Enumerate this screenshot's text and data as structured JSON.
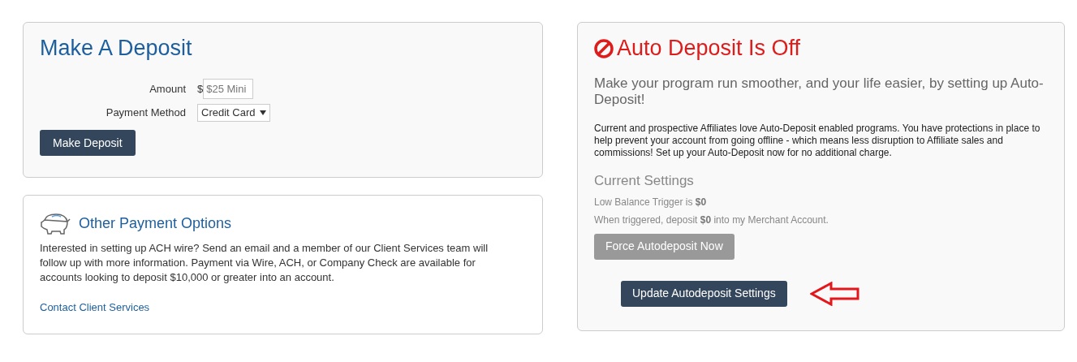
{
  "deposit_card": {
    "title": "Make A Deposit",
    "amount": {
      "label": "Amount",
      "currency": "$",
      "placeholder": "$25 Mini"
    },
    "payment_method": {
      "label": "Payment Method",
      "value": "Credit Card"
    },
    "button": "Make Deposit"
  },
  "other_options_card": {
    "title": "Other Payment Options",
    "text": "Interested in setting up ACH wire? Send an email and a member of our Client Services team will follow up with more information. Payment via Wire, ACH, or Company Check are available for accounts looking to deposit $10,000 or greater into an account.",
    "link": "Contact Client Services"
  },
  "auto_deposit_card": {
    "title": "Auto Deposit Is Off",
    "on": false,
    "subtitle": "Make your program run smoother, and your life easier, by setting up Auto-Deposit!",
    "text": "Current and prospective Affiliates love Auto-Deposit enabled programs. You have protections in place to help prevent your account from going offline - which means less disruption to Affiliate sales and commissions! Set up your Auto-Deposit now for no additional charge.",
    "settings_title": "Current Settings",
    "settings": [
      "Low Balance Trigger is **$0**",
      "When triggered, deposit **$0** into my Merchant Account."
    ],
    "buttons": [
      {
        "label": "Force Autodeposit Now",
        "disabled": true
      },
      {
        "label": "Update Autodeposit Settings",
        "disabled": false
      }
    ]
  }
}
